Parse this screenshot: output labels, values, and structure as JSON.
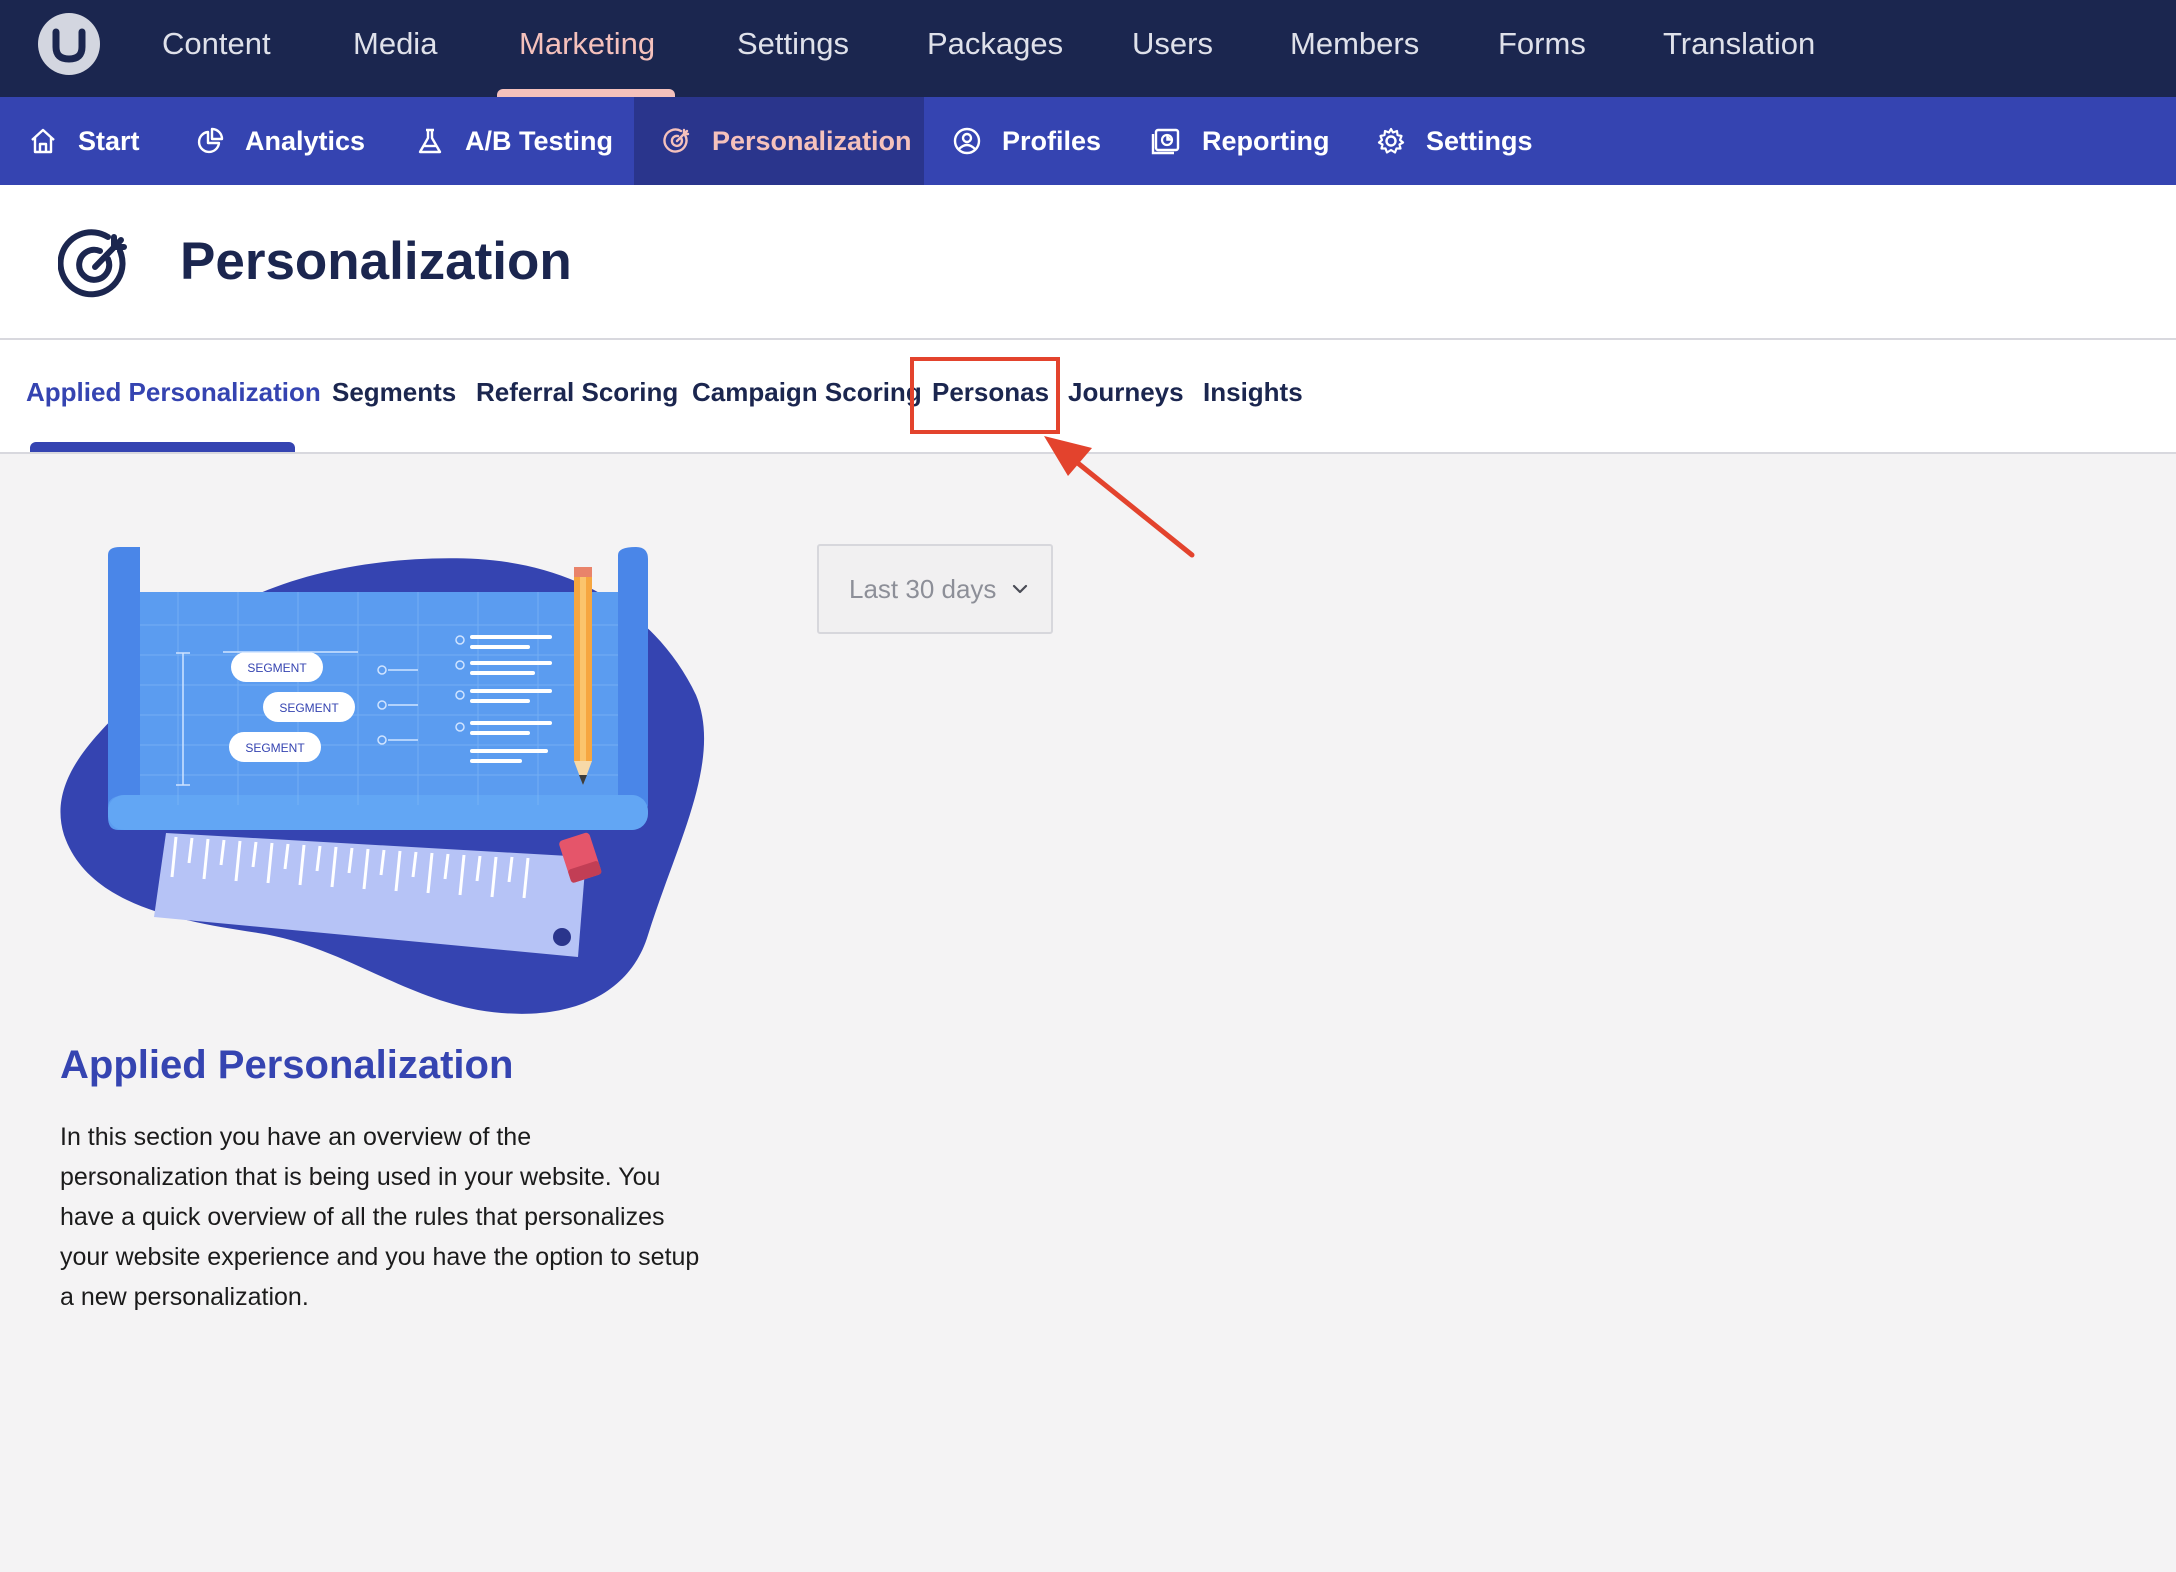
{
  "top_nav": {
    "items": [
      "Content",
      "Media",
      "Marketing",
      "Settings",
      "Packages",
      "Users",
      "Members",
      "Forms",
      "Translation"
    ],
    "active": "Marketing"
  },
  "sub_nav": {
    "items": [
      {
        "label": "Start",
        "icon": "home-icon"
      },
      {
        "label": "Analytics",
        "icon": "pie-chart-icon"
      },
      {
        "label": "A/B Testing",
        "icon": "flask-icon"
      },
      {
        "label": "Personalization",
        "icon": "target-icon"
      },
      {
        "label": "Profiles",
        "icon": "user-circle-icon"
      },
      {
        "label": "Reporting",
        "icon": "report-icon"
      },
      {
        "label": "Settings",
        "icon": "gear-icon"
      }
    ],
    "active": "Personalization"
  },
  "page": {
    "title": "Personalization",
    "icon": "target-icon"
  },
  "tabs": {
    "items": [
      "Applied Personalization",
      "Segments",
      "Referral Scoring",
      "Campaign Scoring",
      "Personas",
      "Journeys",
      "Insights"
    ],
    "active": "Applied Personalization",
    "highlighted": "Personas"
  },
  "illustration": {
    "labels": [
      "SEGMENT",
      "SEGMENT",
      "SEGMENT"
    ]
  },
  "date_filter": {
    "value": "Last 30 days"
  },
  "section": {
    "title": "Applied Personalization",
    "description": "In this section you have an overview of the personalization that is being used in your website. You have a quick overview of all the rules that personalizes your website experience and you have the option to setup a new personalization."
  },
  "colors": {
    "top_nav_bg": "#1b264f",
    "sub_nav_bg": "#3544b1",
    "accent": "#f5c1bc",
    "highlight": "#e3432d"
  }
}
